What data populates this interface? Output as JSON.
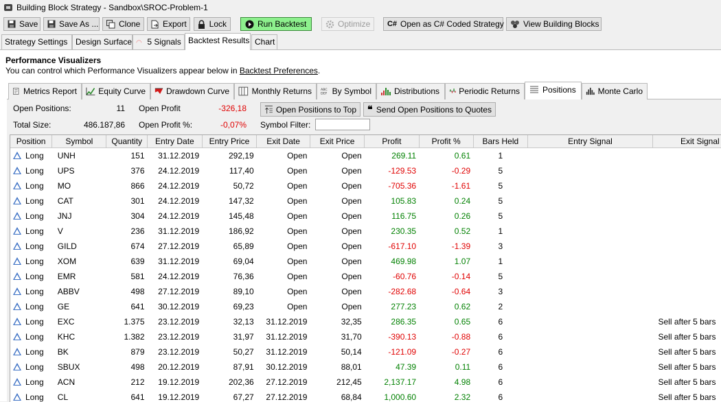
{
  "window": {
    "title": "Building Block Strategy - Sandbox\\SROC-Problem-1"
  },
  "toolbar": {
    "save": "Save",
    "save_as": "Save As ...",
    "clone": "Clone",
    "export": "Export",
    "lock": "Lock",
    "run_backtest": "Run Backtest",
    "optimize": "Optimize",
    "open_csharp": "Open as C# Coded Strategy",
    "view_blocks": "View Building Blocks"
  },
  "main_tabs": [
    "Strategy Settings",
    "Design Surface",
    "5 Signals",
    "Backtest Results",
    "Chart"
  ],
  "visualizers": {
    "title": "Performance Visualizers",
    "subtitle": "You can control which Performance Visualizers appear below in ",
    "link": "Backtest Preferences",
    "period": "."
  },
  "viz_tabs": [
    "Metrics Report",
    "Equity Curve",
    "Drawdown Curve",
    "Monthly Returns",
    "By Symbol",
    "Distributions",
    "Periodic Returns",
    "Positions",
    "Monte Carlo"
  ],
  "summary": {
    "open_positions_label": "Open Positions:",
    "open_positions_value": "11",
    "open_profit_label": "Open Profit",
    "open_profit_value": "-326,18",
    "total_size_label": "Total Size:",
    "total_size_value": "486.187,86",
    "open_profit_pct_label": "Open Profit %:",
    "open_profit_pct_value": "-0,07%",
    "symbol_filter_label": "Symbol Filter:",
    "symbol_filter_value": "",
    "btn_open_to_top": "Open Positions to Top",
    "btn_send_quotes": "Send Open Positions to Quotes"
  },
  "colors": {
    "positive": "#008000",
    "negative": "#e00000",
    "run_button": "#8df08d"
  },
  "table": {
    "columns": [
      "Position",
      "Symbol",
      "Quantity",
      "Entry Date",
      "Entry Price",
      "Exit Date",
      "Exit Price",
      "Profit",
      "Profit %",
      "Bars Held",
      "Entry Signal",
      "Exit Signal"
    ],
    "rows": [
      [
        "Long",
        "UNH",
        "151",
        "31.12.2019",
        "292,19",
        "Open",
        "Open",
        "269.11",
        "0.61",
        "1",
        "",
        ""
      ],
      [
        "Long",
        "UPS",
        "376",
        "24.12.2019",
        "117,40",
        "Open",
        "Open",
        "-129.53",
        "-0.29",
        "5",
        "",
        ""
      ],
      [
        "Long",
        "MO",
        "866",
        "24.12.2019",
        "50,72",
        "Open",
        "Open",
        "-705.36",
        "-1.61",
        "5",
        "",
        ""
      ],
      [
        "Long",
        "CAT",
        "301",
        "24.12.2019",
        "147,32",
        "Open",
        "Open",
        "105.83",
        "0.24",
        "5",
        "",
        ""
      ],
      [
        "Long",
        "JNJ",
        "304",
        "24.12.2019",
        "145,48",
        "Open",
        "Open",
        "116.75",
        "0.26",
        "5",
        "",
        ""
      ],
      [
        "Long",
        "V",
        "236",
        "31.12.2019",
        "186,92",
        "Open",
        "Open",
        "230.35",
        "0.52",
        "1",
        "",
        ""
      ],
      [
        "Long",
        "GILD",
        "674",
        "27.12.2019",
        "65,89",
        "Open",
        "Open",
        "-617.10",
        "-1.39",
        "3",
        "",
        ""
      ],
      [
        "Long",
        "XOM",
        "639",
        "31.12.2019",
        "69,04",
        "Open",
        "Open",
        "469.98",
        "1.07",
        "1",
        "",
        ""
      ],
      [
        "Long",
        "EMR",
        "581",
        "24.12.2019",
        "76,36",
        "Open",
        "Open",
        "-60.76",
        "-0.14",
        "5",
        "",
        ""
      ],
      [
        "Long",
        "ABBV",
        "498",
        "27.12.2019",
        "89,10",
        "Open",
        "Open",
        "-282.68",
        "-0.64",
        "3",
        "",
        ""
      ],
      [
        "Long",
        "GE",
        "641",
        "30.12.2019",
        "69,23",
        "Open",
        "Open",
        "277.23",
        "0.62",
        "2",
        "",
        ""
      ],
      [
        "Long",
        "EXC",
        "1.375",
        "23.12.2019",
        "32,13",
        "31.12.2019",
        "32,35",
        "286.35",
        "0.65",
        "6",
        "",
        "Sell after 5 bars"
      ],
      [
        "Long",
        "KHC",
        "1.382",
        "23.12.2019",
        "31,97",
        "31.12.2019",
        "31,70",
        "-390.13",
        "-0.88",
        "6",
        "",
        "Sell after 5 bars"
      ],
      [
        "Long",
        "BK",
        "879",
        "23.12.2019",
        "50,27",
        "31.12.2019",
        "50,14",
        "-121.09",
        "-0.27",
        "6",
        "",
        "Sell after 5 bars"
      ],
      [
        "Long",
        "SBUX",
        "498",
        "20.12.2019",
        "87,91",
        "30.12.2019",
        "88,01",
        "47.39",
        "0.11",
        "6",
        "",
        "Sell after 5 bars"
      ],
      [
        "Long",
        "ACN",
        "212",
        "19.12.2019",
        "202,36",
        "27.12.2019",
        "212,45",
        "2,137.17",
        "4.98",
        "6",
        "",
        "Sell after 5 bars"
      ],
      [
        "Long",
        "CL",
        "641",
        "19.12.2019",
        "67,27",
        "27.12.2019",
        "68,84",
        "1,000.60",
        "2.32",
        "6",
        "",
        "Sell after 5 bars"
      ]
    ]
  }
}
